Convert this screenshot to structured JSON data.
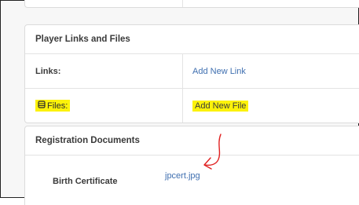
{
  "links_card": {
    "title": "Player Links and Files",
    "rows": [
      {
        "label": "Links:",
        "action": "Add New Link"
      },
      {
        "label": "Files:",
        "action": "Add New File"
      }
    ]
  },
  "registration_card": {
    "title": "Registration Documents",
    "document_label": "Birth Certificate",
    "document_file": "jpcert.jpg"
  },
  "colors": {
    "highlight": "#fcf20a",
    "link": "#3f6fb0",
    "annotation_arrow": "#e02020"
  },
  "icons": {
    "files": "file-stack-icon",
    "annotation": "red-hand-drawn-arrow"
  }
}
